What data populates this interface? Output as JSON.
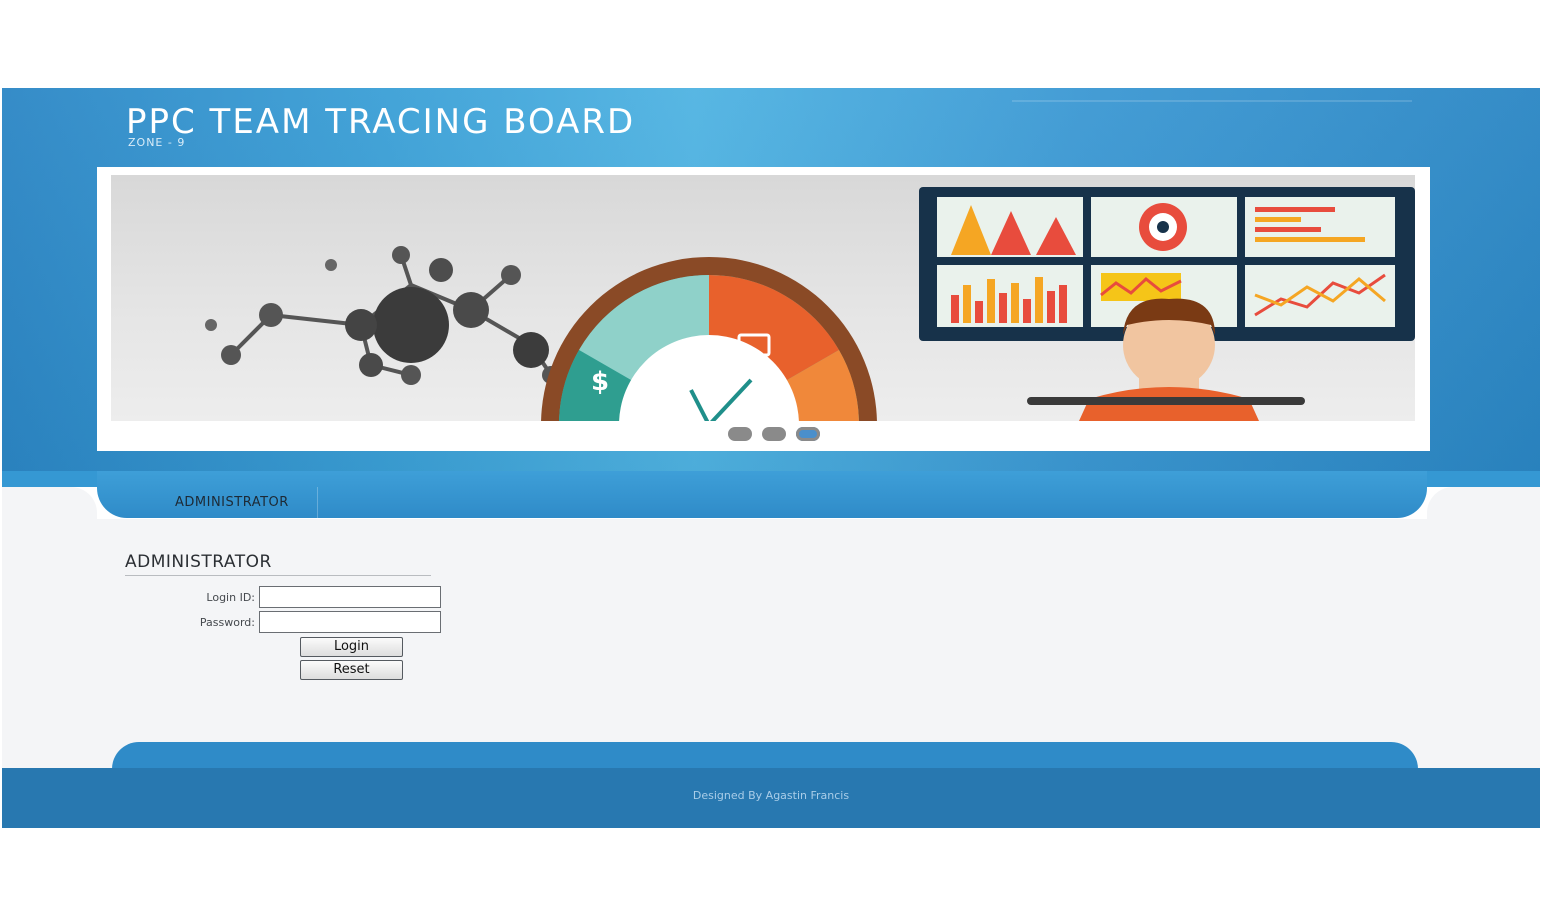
{
  "header": {
    "title": "PPC TEAM TRACING BOARD",
    "subtitle": "ZONE - 9"
  },
  "slider": {
    "slide_count": 3,
    "active_slide": 3
  },
  "nav": {
    "items": [
      {
        "label": "ADMINISTRATOR"
      }
    ]
  },
  "login": {
    "heading": "ADMINISTRATOR",
    "login_id_label": "Login ID:",
    "login_id_value": "",
    "password_label": "Password:",
    "password_value": "",
    "login_button": "Login",
    "reset_button": "Reset"
  },
  "footer": {
    "credit": "Designed By Agastin Francis"
  },
  "colors": {
    "header_blue": "#3a9fd6",
    "footer_blue": "#2878b0",
    "content_bg": "#f4f5f7"
  }
}
